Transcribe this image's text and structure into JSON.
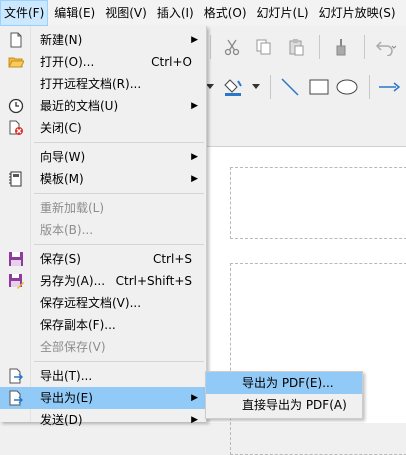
{
  "menubar": {
    "items": [
      "文件(F)",
      "编辑(E)",
      "视图(V)",
      "插入(I)",
      "格式(O)",
      "幻灯片(L)",
      "幻灯片放映(S)"
    ]
  },
  "file_menu": {
    "new": {
      "label": "新建(N)"
    },
    "open": {
      "label": "打开(O)...",
      "shortcut": "Ctrl+O"
    },
    "open_remote": {
      "label": "打开远程文档(R)..."
    },
    "recent": {
      "label": "最近的文档(U)"
    },
    "close": {
      "label": "关闭(C)"
    },
    "wizard": {
      "label": "向导(W)"
    },
    "template": {
      "label": "模板(M)"
    },
    "reload": {
      "label": "重新加载(L)"
    },
    "versions": {
      "label": "版本(B)..."
    },
    "save": {
      "label": "保存(S)",
      "shortcut": "Ctrl+S"
    },
    "save_as": {
      "label": "另存为(A)...",
      "shortcut": "Ctrl+Shift+S"
    },
    "save_remote": {
      "label": "保存远程文档(V)..."
    },
    "save_copy": {
      "label": "保存副本(F)..."
    },
    "save_all": {
      "label": "全部保存(V)"
    },
    "export": {
      "label": "导出(T)..."
    },
    "export_as": {
      "label": "导出为(E)"
    },
    "send": {
      "label": "发送(D)"
    }
  },
  "export_submenu": {
    "items": [
      "导出为 PDF(E)...",
      "直接导出为 PDF(A)"
    ]
  },
  "colors": {
    "highlight": "#91c9f7",
    "menubar_active": "#cce8ff",
    "disabled_text": "#8d8d8d"
  }
}
